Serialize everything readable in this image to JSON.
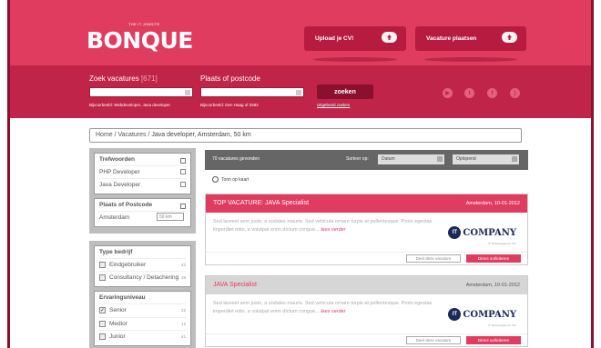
{
  "header": {
    "logo": "BONQUE",
    "tagline": "THE IT JOBSITE",
    "upload_label": "Upload je CV!",
    "vacature_label": "Vacature plaatsen"
  },
  "search": {
    "vacatures_label": "Zoek vacatures",
    "vacatures_count": "[671]",
    "plaats_label": "Plaats of postcode",
    "vacatures_hint": "Bijvoorbeeld: Webdeveloper, Java developer",
    "plaats_hint": "Bijvoorbeeld: Den Haag of 2582",
    "search_button": "zoeken",
    "advanced_link": "Uitgebreid zoeken"
  },
  "social": {
    "icons": [
      "youtube-icon",
      "twitter-icon",
      "facebook-icon",
      "rss-icon"
    ]
  },
  "breadcrumb": {
    "path": "Home / Vacatures / ",
    "current": "Java developer, Amsterdam, 50 km"
  },
  "filters": {
    "trefwoorden_title": "Trefwoorden",
    "trefwoorden": [
      "PHP Developer",
      "Java Developer"
    ],
    "plaats_title": "Plaats of Postcode",
    "plaats_value": "Amsterdam",
    "km_value": "50 km",
    "type_title": "Type bedrijf",
    "types": [
      {
        "label": "Eindgebruiker",
        "count": "42",
        "checked": false
      },
      {
        "label": "Consultancy / Detachering",
        "count": "28",
        "checked": false
      }
    ],
    "ervaring_title": "Ervaringsniveau",
    "ervaring": [
      {
        "label": "Senior",
        "count": "22",
        "checked": true
      },
      {
        "label": "Medior",
        "count": "12",
        "checked": false
      },
      {
        "label": "Junior",
        "count": "41",
        "checked": false
      }
    ]
  },
  "results": {
    "count_text": "70 vacatures gevonden",
    "sort_label": "Sorteer op:",
    "sort_value": "Datum",
    "order_value": "Oplopend",
    "map_link": "Toon op kaart"
  },
  "cards": [
    {
      "title": "TOP VACATURE: JAVA Specialist",
      "location_date": "Amsterdam, 10-01-2012",
      "text": "Sed laoreet sem justo, a sodales mauris. Sed vehicula ornare turpis at pellentesque. Proin egestas imperdiet odio, a volutpat enim dictum congue...",
      "more": "lees verder",
      "company": "COMPANY",
      "company_tag": "IT Technologies for You",
      "share": "Deel deze vacature",
      "apply": "Direct solliciteren",
      "accent": "#e03c5f"
    },
    {
      "title": "JAVA Specialist",
      "location_date": "Amsterdam, 10-01-2012",
      "text": "Sed laoreet sem justo, a sodales mauris. Sed vehicula ornare turpis at pellentesque. Proin egestas imperdiet odio, a volutpat enim dictum congue...",
      "more": "lees verder",
      "company": "COMPANY",
      "company_tag": "IT Technologies for You",
      "share": "Deel deze vacature",
      "apply": "Direct solliciteren",
      "accent": "#d6d6d6"
    }
  ],
  "colors": {
    "brand": "#e03c5f",
    "dark": "#8b0f2f",
    "search_bg": "#c02448"
  }
}
